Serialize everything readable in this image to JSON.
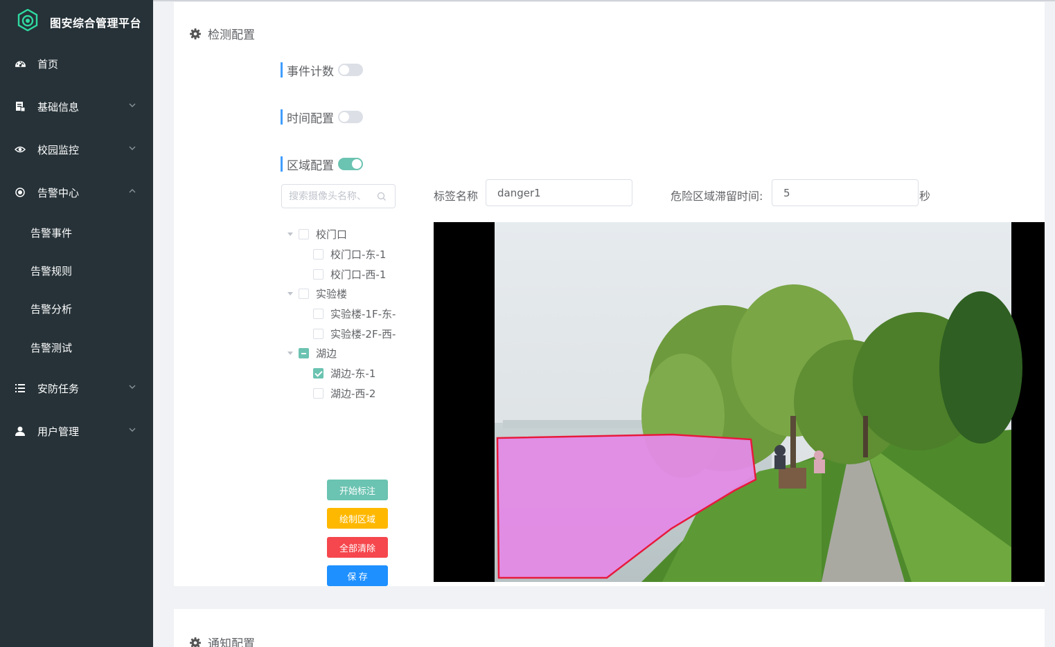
{
  "app": {
    "title": "图安综合管理平台"
  },
  "sidebar": {
    "items": [
      {
        "label": "首页",
        "icon": "dashboard-icon"
      },
      {
        "label": "基础信息",
        "icon": "document-icon"
      },
      {
        "label": "校园监控",
        "icon": "eye-icon"
      },
      {
        "label": "告警中心",
        "icon": "alarm-icon",
        "expanded": true
      },
      {
        "label": "安防任务",
        "icon": "list-icon"
      },
      {
        "label": "用户管理",
        "icon": "user-icon"
      }
    ],
    "subitems": [
      {
        "label": "告警事件"
      },
      {
        "label": "告警规则"
      },
      {
        "label": "告警分析"
      },
      {
        "label": "告警测试"
      }
    ]
  },
  "detect": {
    "title": "检测配置",
    "event_count": {
      "label": "事件计数",
      "on": false
    },
    "time_config": {
      "label": "时间配置",
      "on": false
    },
    "area_config": {
      "label": "区域配置",
      "on": true
    },
    "search": {
      "placeholder": "搜索摄像头名称、"
    },
    "tree": [
      {
        "label": "校门口",
        "state": "unchecked",
        "children": [
          {
            "label": "校门口-东-1",
            "state": "unchecked"
          },
          {
            "label": "校门口-西-1",
            "state": "unchecked"
          }
        ]
      },
      {
        "label": "实验楼",
        "state": "unchecked",
        "children": [
          {
            "label": "实验楼-1F-东-",
            "state": "unchecked"
          },
          {
            "label": "实验楼-2F-西-",
            "state": "unchecked"
          }
        ]
      },
      {
        "label": "湖边",
        "state": "indeterminate",
        "children": [
          {
            "label": "湖边-东-1",
            "state": "checked"
          },
          {
            "label": "湖边-西-2",
            "state": "unchecked"
          }
        ]
      }
    ],
    "tag_name": {
      "label": "标签名称",
      "value": "danger1"
    },
    "stay_time": {
      "label": "危险区域滞留时间:",
      "value": "5",
      "unit": "秒"
    },
    "buttons": {
      "start": "开始标注",
      "draw": "绘制区域",
      "clear": "全部清除",
      "save": "保 存"
    }
  },
  "notify": {
    "title": "通知配置"
  },
  "colors": {
    "sidebar": "#263238",
    "accent": "#6bc3b1",
    "draw": "#ffb800",
    "clear": "#f5474d",
    "save": "#1e90ff",
    "region_fill": "#e38ae6",
    "region_stroke": "#e8193c"
  }
}
